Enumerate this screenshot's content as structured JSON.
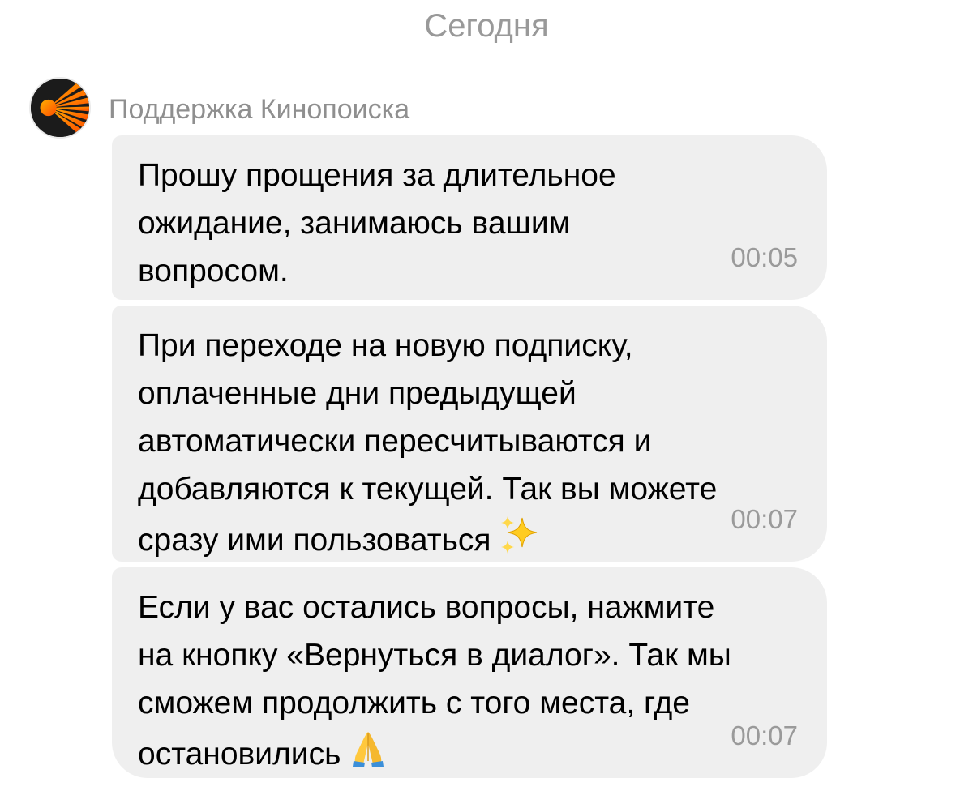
{
  "date_separator": "Сегодня",
  "sender": {
    "name": "Поддержка Кинопоиска",
    "avatar_icon": "kinopoisk-logo-icon",
    "avatar_colors": {
      "background": "#1b1b1b",
      "accent": "#ff6a00"
    }
  },
  "messages": [
    {
      "text": "Прошу прощения за длительное\nожидание, занимаюсь вашим\nвопросом.",
      "time": "00:05"
    },
    {
      "text": "При переходе на новую подписку,\nоплаченные дни предыдущей\nавтоматически пересчитываются и\nдобавляются к текущей. Так вы можете\nсразу ими пользоваться",
      "emoji": "sparkles-icon",
      "time": "00:07"
    },
    {
      "text": "Если у вас остались вопросы, нажмите\nна кнопку «Вернуться в диалог». Так мы\nсможем продолжить с того места, где\nостановились",
      "emoji": "folded-hands-icon",
      "time": "00:07"
    }
  ],
  "colors": {
    "bubble": "#efefef",
    "meta_text": "#9a9a9a"
  }
}
